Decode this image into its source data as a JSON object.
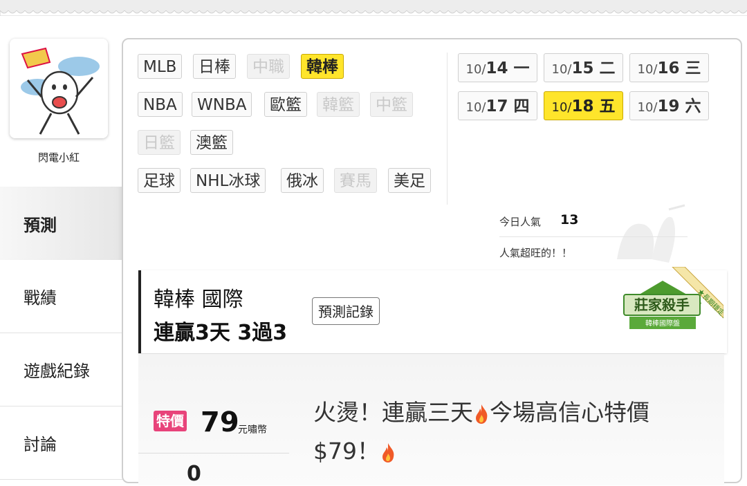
{
  "user": {
    "name": "閃電小紅"
  },
  "nav": [
    {
      "label": "預測",
      "active": true
    },
    {
      "label": "戰績",
      "active": false
    },
    {
      "label": "遊戲紀錄",
      "active": false
    },
    {
      "label": "討論",
      "active": false
    }
  ],
  "leagues": [
    {
      "label": "MLB",
      "state": "normal"
    },
    {
      "label": "日棒",
      "state": "normal"
    },
    {
      "label": "中職",
      "state": "disabled"
    },
    {
      "label": "韓棒",
      "state": "active"
    },
    {
      "label": "NBA",
      "state": "normal"
    },
    {
      "label": "WNBA",
      "state": "normal"
    },
    {
      "label": "歐籃",
      "state": "normal"
    },
    {
      "label": "韓籃",
      "state": "disabled"
    },
    {
      "label": "中籃",
      "state": "disabled"
    },
    {
      "label": "日籃",
      "state": "disabled"
    },
    {
      "label": "澳籃",
      "state": "normal"
    },
    {
      "label": "足球",
      "state": "normal"
    },
    {
      "label": "NHL冰球",
      "state": "normal"
    },
    {
      "label": "俄冰",
      "state": "normal"
    },
    {
      "label": "賽馬",
      "state": "disabled"
    },
    {
      "label": "美足",
      "state": "normal"
    }
  ],
  "dates": [
    {
      "md": "10/",
      "d": "14 一",
      "active": false
    },
    {
      "md": "10/",
      "d": "15 二",
      "active": false
    },
    {
      "md": "10/",
      "d": "16 三",
      "active": false
    },
    {
      "md": "10/",
      "d": "17 四",
      "active": false
    },
    {
      "md": "10/",
      "d": "18 五",
      "active": true
    },
    {
      "md": "10/",
      "d": "19 六",
      "active": false
    }
  ],
  "popularity": {
    "label": "今日人氣",
    "value": "13",
    "note": "人氣超旺的！！"
  },
  "record": {
    "title": "韓棒 國際",
    "streak": "連贏3天 3過3",
    "history_button": "預測記錄",
    "badge_title": "莊家殺手",
    "badge_sub": "韓棒國際盤",
    "ribbon": "★長期穩定★"
  },
  "offer": {
    "badge": "特價",
    "price": "79",
    "unit": "元嘯幣",
    "line1": "火燙！連贏三天",
    "line1b": "今場高信心特價",
    "line2": "$79！",
    "partial": "0"
  },
  "colors": {
    "accent": "#ffe52b",
    "sale": "#e8437a",
    "badge_green": "#3e8a2a"
  }
}
